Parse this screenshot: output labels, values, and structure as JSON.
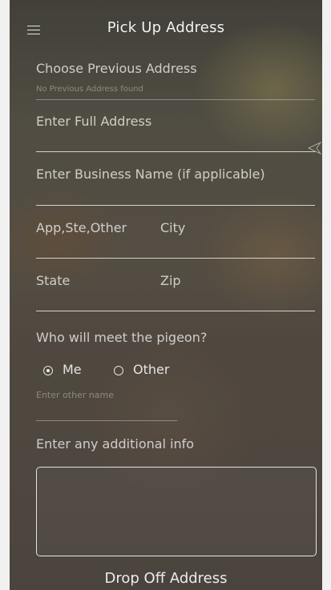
{
  "header": {
    "title": "Pick Up Address"
  },
  "form": {
    "previous_address_label": "Choose Previous Address",
    "previous_address_status": "No Previous Address found",
    "full_address_placeholder": "Enter Full Address",
    "business_name_placeholder": "Enter Business Name (if applicable)",
    "apt_placeholder": "App,Ste,Other",
    "city_placeholder": "City",
    "state_placeholder": "State",
    "zip_placeholder": "Zip",
    "meet_question": "Who will meet the pigeon?",
    "radio_me_label": "Me",
    "radio_other_label": "Other",
    "other_name_placeholder": "Enter other name",
    "additional_info_label": "Enter any additional info"
  },
  "footer": {
    "next_section_title": "Drop Off Address"
  },
  "icons": {
    "menu": "hamburger-icon",
    "send": "send-icon"
  },
  "colors": {
    "text": "#f2f2f2",
    "line": "#e6e6e6"
  }
}
